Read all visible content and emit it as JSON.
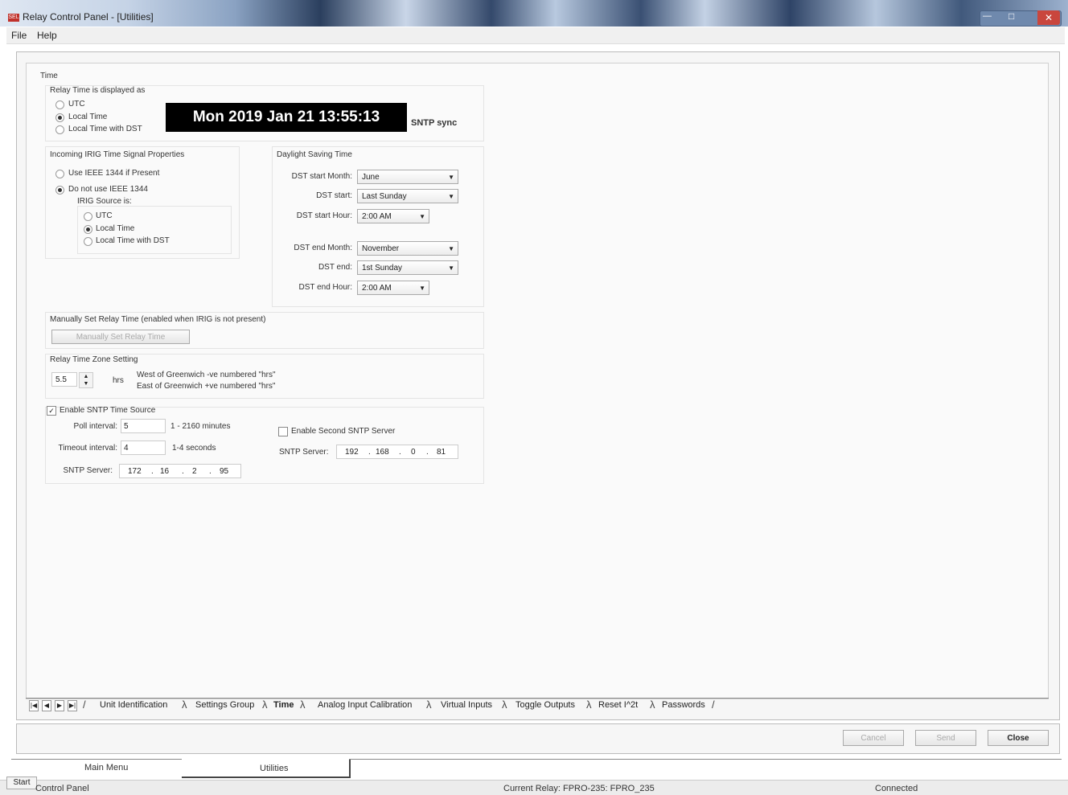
{
  "window": {
    "title": "Relay Control Panel - [Utilities]",
    "icon_label": "SEL"
  },
  "menu": {
    "file": "File",
    "help": "Help"
  },
  "time": {
    "section": "Time",
    "display_label": "Relay Time is displayed as",
    "display_options": [
      "UTC",
      "Local Time",
      "Local Time with DST"
    ],
    "display_selected": "Local Time",
    "clock": "Mon 2019 Jan 21  13:55:13",
    "sntp_sync": "SNTP sync"
  },
  "irig": {
    "title": "Incoming IRIG Time Signal Properties",
    "opt_use": "Use IEEE 1344 if Present",
    "opt_not": "Do not use IEEE 1344",
    "source_label": "IRIG Source is:",
    "source_options": [
      "UTC",
      "Local Time",
      "Local Time with DST"
    ],
    "source_selected": "Local Time"
  },
  "dst": {
    "title": "Daylight Saving Time",
    "start_month_label": "DST start Month:",
    "start_month": "June",
    "start_label": "DST start:",
    "start": "Last Sunday",
    "start_hour_label": "DST start Hour:",
    "start_hour": "2:00 AM",
    "end_month_label": "DST end Month:",
    "end_month": "November",
    "end_label": "DST end:",
    "end": "1st Sunday",
    "end_hour_label": "DST end Hour:",
    "end_hour": "2:00 AM"
  },
  "manual": {
    "title": "Manually Set Relay Time (enabled when IRIG is not present)",
    "button": "Manually Set Relay Time"
  },
  "tz": {
    "title": "Relay Time Zone Setting",
    "value": "5.5",
    "unit": "hrs",
    "note1": "West of Greenwich -ve numbered \"hrs\"",
    "note2": "East of Greenwich +ve numbered \"hrs\""
  },
  "sntp": {
    "enable_label": "Enable SNTP Time Source",
    "poll_label": "Poll interval:",
    "poll_value": "5",
    "poll_unit": "1 - 2160 minutes",
    "timeout_label": "Timeout interval:",
    "timeout_value": "4",
    "timeout_unit": "1-4 seconds",
    "server_label": "SNTP Server:",
    "server": [
      "172",
      "16",
      "2",
      "95"
    ],
    "second_enable_label": "Enable Second SNTP Server",
    "second_server_label": "SNTP Server:",
    "second_server": [
      "192",
      "168",
      "0",
      "81"
    ]
  },
  "tabs": [
    "Unit Identification",
    "Settings Group",
    "Time",
    "Analog Input Calibration",
    "Virtual Inputs",
    "Toggle Outputs",
    "Reset I^2t",
    "Passwords"
  ],
  "active_tab": "Time",
  "actions": {
    "cancel": "Cancel",
    "send": "Send",
    "close": "Close"
  },
  "bottom_tabs": {
    "main_menu": "Main Menu",
    "utilities": "Utilities"
  },
  "status": {
    "left": "Control Panel",
    "start": "Start",
    "current_relay": "Current Relay: FPRO-235: FPRO_235",
    "connection": "Connected"
  }
}
